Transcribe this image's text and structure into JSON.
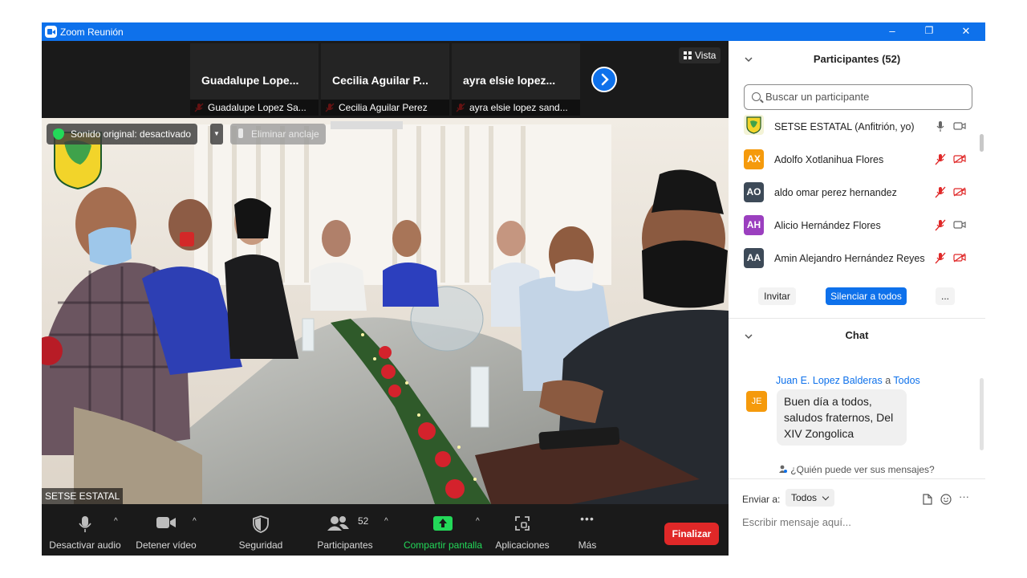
{
  "window": {
    "title": "Zoom Reunión",
    "controls": [
      "–",
      "❐",
      "✕"
    ]
  },
  "filmstrip": {
    "tiles": [
      {
        "big_name": "Guadalupe  Lope...",
        "small_name": "Guadalupe Lopez Sa..."
      },
      {
        "big_name": "Cecilia Aguilar P...",
        "small_name": "Cecilia Aguilar Perez"
      },
      {
        "big_name": "ayra elsie  lopez...",
        "small_name": "ayra elsie lopez sand..."
      }
    ],
    "vista_label": "Vista"
  },
  "video": {
    "original_sound": "Sonido original: desactivado",
    "dropdown_glyph": "▼",
    "unpin_label": "Eliminar anclaje",
    "speaker_name": "SETSE ESTATAL"
  },
  "toolbar": {
    "mute_label": "Desactivar audio",
    "video_label": "Detener vídeo",
    "security_label": "Seguridad",
    "participants_label": "Participantes",
    "participants_count": "52",
    "share_label": "Compartir pantalla",
    "apps_label": "Aplicaciones",
    "more_label": "Más",
    "more_glyph": "•••",
    "caret_glyph": "^",
    "end_label": "Finalizar"
  },
  "participants": {
    "header": "Participantes (52)",
    "search_placeholder": "Buscar un participante",
    "items": [
      {
        "initials": "",
        "name": "SETSE ESTATAL (Anfitrión, yo)",
        "color": "#f3f3d6",
        "muted": false,
        "video_off": false
      },
      {
        "initials": "AX",
        "name": "Adolfo Xotlanihua Flores",
        "color": "#f59a0c",
        "muted": true,
        "video_off": true
      },
      {
        "initials": "AO",
        "name": "aldo omar perez hernandez",
        "color": "#3d4a58",
        "muted": true,
        "video_off": true
      },
      {
        "initials": "AH",
        "name": "Alicio Hernández Flores",
        "color": "#9b3fbf",
        "muted": true,
        "video_off": false
      },
      {
        "initials": "AA",
        "name": "Amin Alejandro Hernández Reyes",
        "color": "#3d4a58",
        "muted": true,
        "video_off": true
      }
    ],
    "invite_label": "Invitar",
    "mute_all_label": "Silenciar a todos",
    "more_label": "..."
  },
  "chat": {
    "header": "Chat",
    "sender": "Juan E. Lopez Balderas",
    "to_word": "a",
    "recipient": "Todos",
    "avatar_initials": "JE",
    "message": "Buen día a todos, saludos fraternos, Del XIV Zongolica",
    "who_can_see": "¿Quién puede ver sus mensajes?",
    "send_to_label": "Enviar a:",
    "send_to_value": "Todos",
    "input_placeholder": "Escribir mensaje aquí...",
    "more_glyph": "···"
  },
  "colors": {
    "zoom_blue": "#0e71eb",
    "dark_bg": "#1a1a1a",
    "end_red": "#e02828",
    "share_green": "#23d959",
    "muted_red": "#e02828"
  }
}
